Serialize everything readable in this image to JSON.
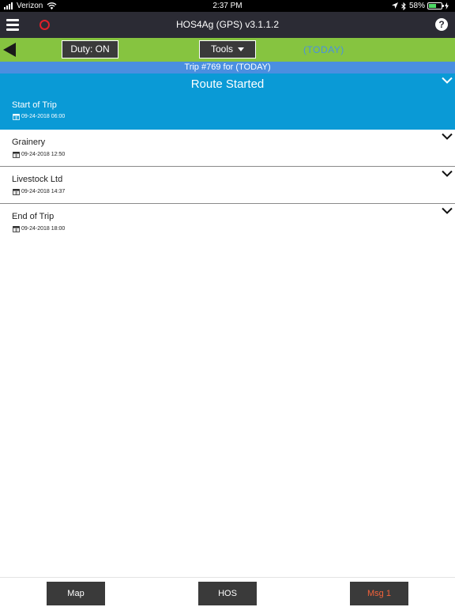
{
  "status_bar": {
    "carrier": "Verizon",
    "time": "2:37 PM",
    "battery_percent": "58%",
    "battery_level": 0.58
  },
  "title_bar": {
    "title": "HOS4Ag (GPS) v3.1.1.2",
    "help_glyph": "?"
  },
  "toolbar": {
    "duty_label": "Duty: ON",
    "tools_label": "Tools",
    "today_label": "(TODAY)"
  },
  "trip": {
    "title": "Trip #769 for (TODAY)"
  },
  "route": {
    "status": "Route Started",
    "stops": [
      {
        "name": "Start of Trip",
        "datetime": "09-24-2018 06:00"
      },
      {
        "name": "Grainery",
        "datetime": "09-24-2018 12:50"
      },
      {
        "name": "Livestock Ltd",
        "datetime": "09-24-2018 14:37"
      },
      {
        "name": "End of Trip",
        "datetime": "09-24-2018 18:00"
      }
    ]
  },
  "bottom_bar": {
    "map_label": "Map",
    "hos_label": "HOS",
    "msg_label": "Msg 1"
  },
  "colors": {
    "title_bar": "#2b2b34",
    "toolbar_green": "#86c440",
    "trip_blue": "#4a8fe0",
    "route_blue": "#0a9ad6",
    "record_red": "#e0202a",
    "msg_orange": "#f4623a",
    "today_blue": "#4a90e2"
  }
}
